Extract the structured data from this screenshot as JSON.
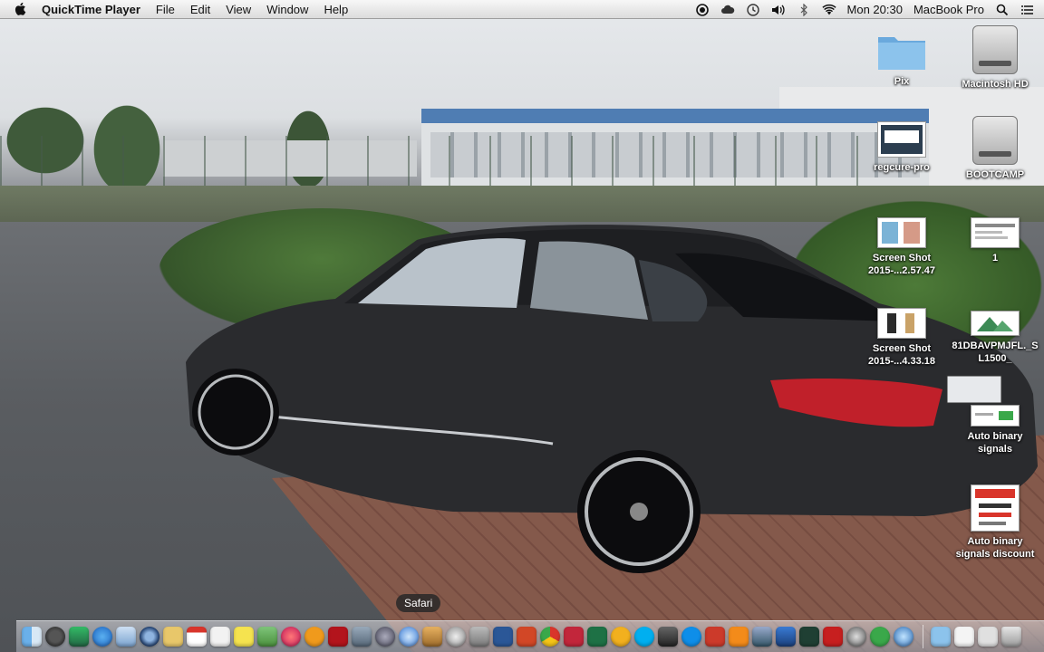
{
  "menubar": {
    "apple_icon": "apple-icon",
    "app_name": "QuickTime Player",
    "menus": [
      "File",
      "Edit",
      "View",
      "Window",
      "Help"
    ],
    "status": {
      "icons": [
        "record-icon",
        "cloud-icon",
        "time-machine-icon",
        "volume-icon",
        "bluetooth-icon",
        "wifi-icon"
      ],
      "clock": "Mon 20:30",
      "computer_name": "MacBook Pro",
      "search_icon": "spotlight-search-icon",
      "list_icon": "notification-list-icon"
    }
  },
  "desktop": {
    "icons": [
      {
        "name": "folder-pix",
        "label_lines": [
          "Pix"
        ],
        "type": "folder"
      },
      {
        "name": "drive-macintosh-hd",
        "label_lines": [
          "Macintosh HD"
        ],
        "type": "drive"
      },
      {
        "name": "file-regcure-pro",
        "label_lines": [
          "regcure-pro"
        ],
        "type": "app"
      },
      {
        "name": "drive-bootcamp",
        "label_lines": [
          "BOOTCAMP"
        ],
        "type": "drive"
      },
      {
        "name": "file-screen-shot-1",
        "label_lines": [
          "Screen Shot",
          "2015-...2.57.47"
        ],
        "type": "doc"
      },
      {
        "name": "file-1",
        "label_lines": [
          "1"
        ],
        "type": "doc"
      },
      {
        "name": "file-screen-shot-2",
        "label_lines": [
          "Screen Shot",
          "2015-...4.33.18"
        ],
        "type": "doc"
      },
      {
        "name": "file-81dbavpmjfl",
        "label_lines": [
          "81DBAVPMJFL._S",
          "L1500_"
        ],
        "type": "doc"
      },
      {
        "name": "file-auto-binary-signals",
        "label_lines": [
          "Auto binary",
          "signals"
        ],
        "type": "doc"
      },
      {
        "name": "file-auto-binary-signals-discount",
        "label_lines": [
          "Auto binary",
          "signals discount"
        ],
        "type": "doc"
      }
    ]
  },
  "dock": {
    "tooltip": "Safari",
    "colors": {
      "accent_blue": "#3a7bd5",
      "accent_red": "#d9352b",
      "accent_green": "#3aa84a",
      "accent_orange": "#f09a1c",
      "menubar_text": "#111111"
    },
    "items": [
      "finder-icon",
      "dashboard-icon",
      "mission-control-icon",
      "app-store-icon",
      "preview-icon",
      "quicktime-icon",
      "notes-icon",
      "calendar-icon",
      "text-edit-icon",
      "stickies-icon",
      "photos-icon",
      "itunes-icon",
      "ibooks-icon",
      "flash-icon",
      "image-capture-icon",
      "launchpad-icon",
      "safari-icon",
      "garageband-icon",
      "dvd-player-icon",
      "automator-icon",
      "word-icon",
      "powerpoint-icon",
      "chrome-icon",
      "parallels-icon",
      "excel-icon",
      "outlook-icon",
      "skype-icon",
      "photo-booth-icon",
      "teamviewer-icon",
      "photoshop-icon",
      "vlc-icon",
      "paintbrush-icon",
      "xcode-icon",
      "terminal-icon",
      "acrobat-icon",
      "alfred-icon",
      "utorrent-icon",
      "quicksilver-icon",
      "downloads-folder-icon",
      "documents-stack-icon",
      "files-stack-icon",
      "trash-icon"
    ]
  }
}
